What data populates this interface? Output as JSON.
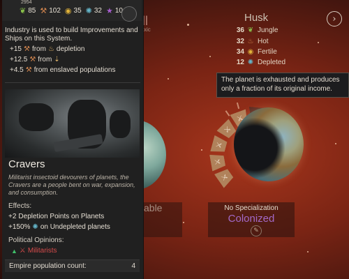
{
  "resources": {
    "top_fragment": "2954",
    "items": [
      {
        "icon": "leaf-icon",
        "glyph": "🌿",
        "value": "85",
        "color": "#8ac14a"
      },
      {
        "icon": "industry-icon",
        "glyph": "⚒",
        "value": "102",
        "color": "#d4874f"
      },
      {
        "icon": "dust-icon",
        "glyph": "◉",
        "value": "35",
        "color": "#e0b23a"
      },
      {
        "icon": "science-icon",
        "glyph": "✺",
        "value": "32",
        "color": "#64b5c9"
      },
      {
        "icon": "influence-icon",
        "glyph": "★",
        "value": "10",
        "color": "#a85fd0"
      }
    ]
  },
  "industry_info": {
    "description": "Industry is used to build Improvements and Ships on this System.",
    "lines": [
      {
        "value": "+15",
        "from": "from",
        "source": "depletion",
        "source_icon": "flame-icon"
      },
      {
        "value": "+12.5",
        "from": "from",
        "source": "",
        "source_icon": "population-icon"
      },
      {
        "value": "+4.5",
        "from": "from enslaved populations",
        "source": "",
        "source_icon": ""
      }
    ]
  },
  "race": {
    "name": "Cravers",
    "description": "Militarist insectoid devourers of planets, the Cravers are a people bent on war, expansion, and consumption.",
    "effects_title": "Effects:",
    "effects": [
      {
        "value": "+2",
        "text": "Depletion Points on Planets"
      },
      {
        "value": "+150%",
        "text": "on Undepleted planets"
      }
    ],
    "opinions_title": "Political Opinions:",
    "opinion": "Militarists",
    "population_label": "Empire population count:",
    "population_value": "4"
  },
  "planet": {
    "name": "Husk",
    "left_name_fragment": "ll",
    "left_subtitle_fragment": "xic",
    "left_spec_fragment": "able",
    "traits": [
      {
        "value": "36",
        "icon": "jungle-icon",
        "glyph": "❦",
        "color": "#8ac14a",
        "label": "Jungle"
      },
      {
        "value": "32",
        "icon": "hot-icon",
        "glyph": "♨",
        "color": "#d4874f",
        "label": "Hot"
      },
      {
        "value": "34",
        "icon": "fertile-icon",
        "glyph": "◉",
        "color": "#e0b23a",
        "label": "Fertile"
      },
      {
        "value": "12",
        "icon": "depleted-icon",
        "glyph": "✺",
        "color": "#64b5c9",
        "label": "Depleted"
      }
    ],
    "tooltip": "The planet is exhausted and produces only a fraction of its original income.",
    "specialization": "No Specialization",
    "status": "Colonized"
  }
}
